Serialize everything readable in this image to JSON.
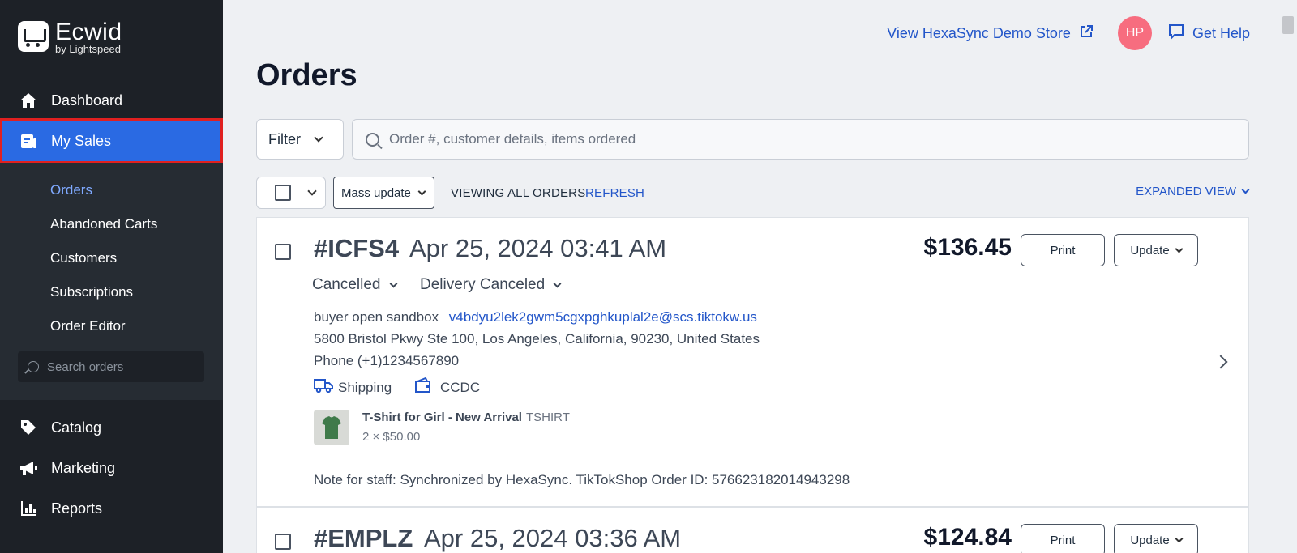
{
  "brand": {
    "name": "Ecwid",
    "sub": "by Lightspeed"
  },
  "sidebar": {
    "items": [
      {
        "label": "Dashboard",
        "icon": "home-icon"
      },
      {
        "label": "My Sales",
        "icon": "receipt-icon"
      },
      {
        "label": "Catalog",
        "icon": "tag-icon"
      },
      {
        "label": "Marketing",
        "icon": "megaphone-icon"
      },
      {
        "label": "Reports",
        "icon": "bar-chart-icon"
      }
    ],
    "sub_items": [
      "Orders",
      "Abandoned Carts",
      "Customers",
      "Subscriptions",
      "Order Editor"
    ],
    "search_placeholder": "Search orders"
  },
  "header": {
    "store_link": "View HexaSync Demo Store",
    "avatar_initials": "HP",
    "help": "Get Help"
  },
  "main": {
    "title": "Orders",
    "filter_label": "Filter",
    "search_placeholder": "Order #, customer details, items ordered",
    "mass_update": "Mass update",
    "viewing": "VIEWING ALL ORDERS",
    "refresh": "REFRESH",
    "expanded_view": "EXPANDED VIEW"
  },
  "orders": [
    {
      "number": "#ICFS4",
      "date": "Apr 25, 2024 03:41 AM",
      "total": "$136.45",
      "print": "Print",
      "update": "Update",
      "payment_status": "Cancelled",
      "fulfillment_status": "Delivery Canceled",
      "customer_name": "buyer open sandbox",
      "email": "v4bdyu2lek2gwm5cgxpghkuplal2e@scs.tiktokw.us",
      "address": "5800 Bristol Pkwy Ste 100, Los Angeles, California, 90230, United States",
      "phone": "Phone (+1)1234567890",
      "shipping": "Shipping",
      "payment": "CCDC",
      "item_name": "T-Shirt for Girl - New Arrival",
      "item_sku": "TSHIRT",
      "item_qty": "2 × $50.00",
      "note": "Note for staff: Synchronized by HexaSync. TikTokShop Order ID: 576623182014943298"
    },
    {
      "number": "#EMPLZ",
      "date": "Apr 25, 2024 03:36 AM",
      "total": "$124.84",
      "print": "Print",
      "update": "Update"
    }
  ],
  "colors": {
    "sidebar": "#1d2127",
    "active": "#2a6ae3",
    "link": "#2356c9",
    "avatar": "#f76d7f"
  }
}
